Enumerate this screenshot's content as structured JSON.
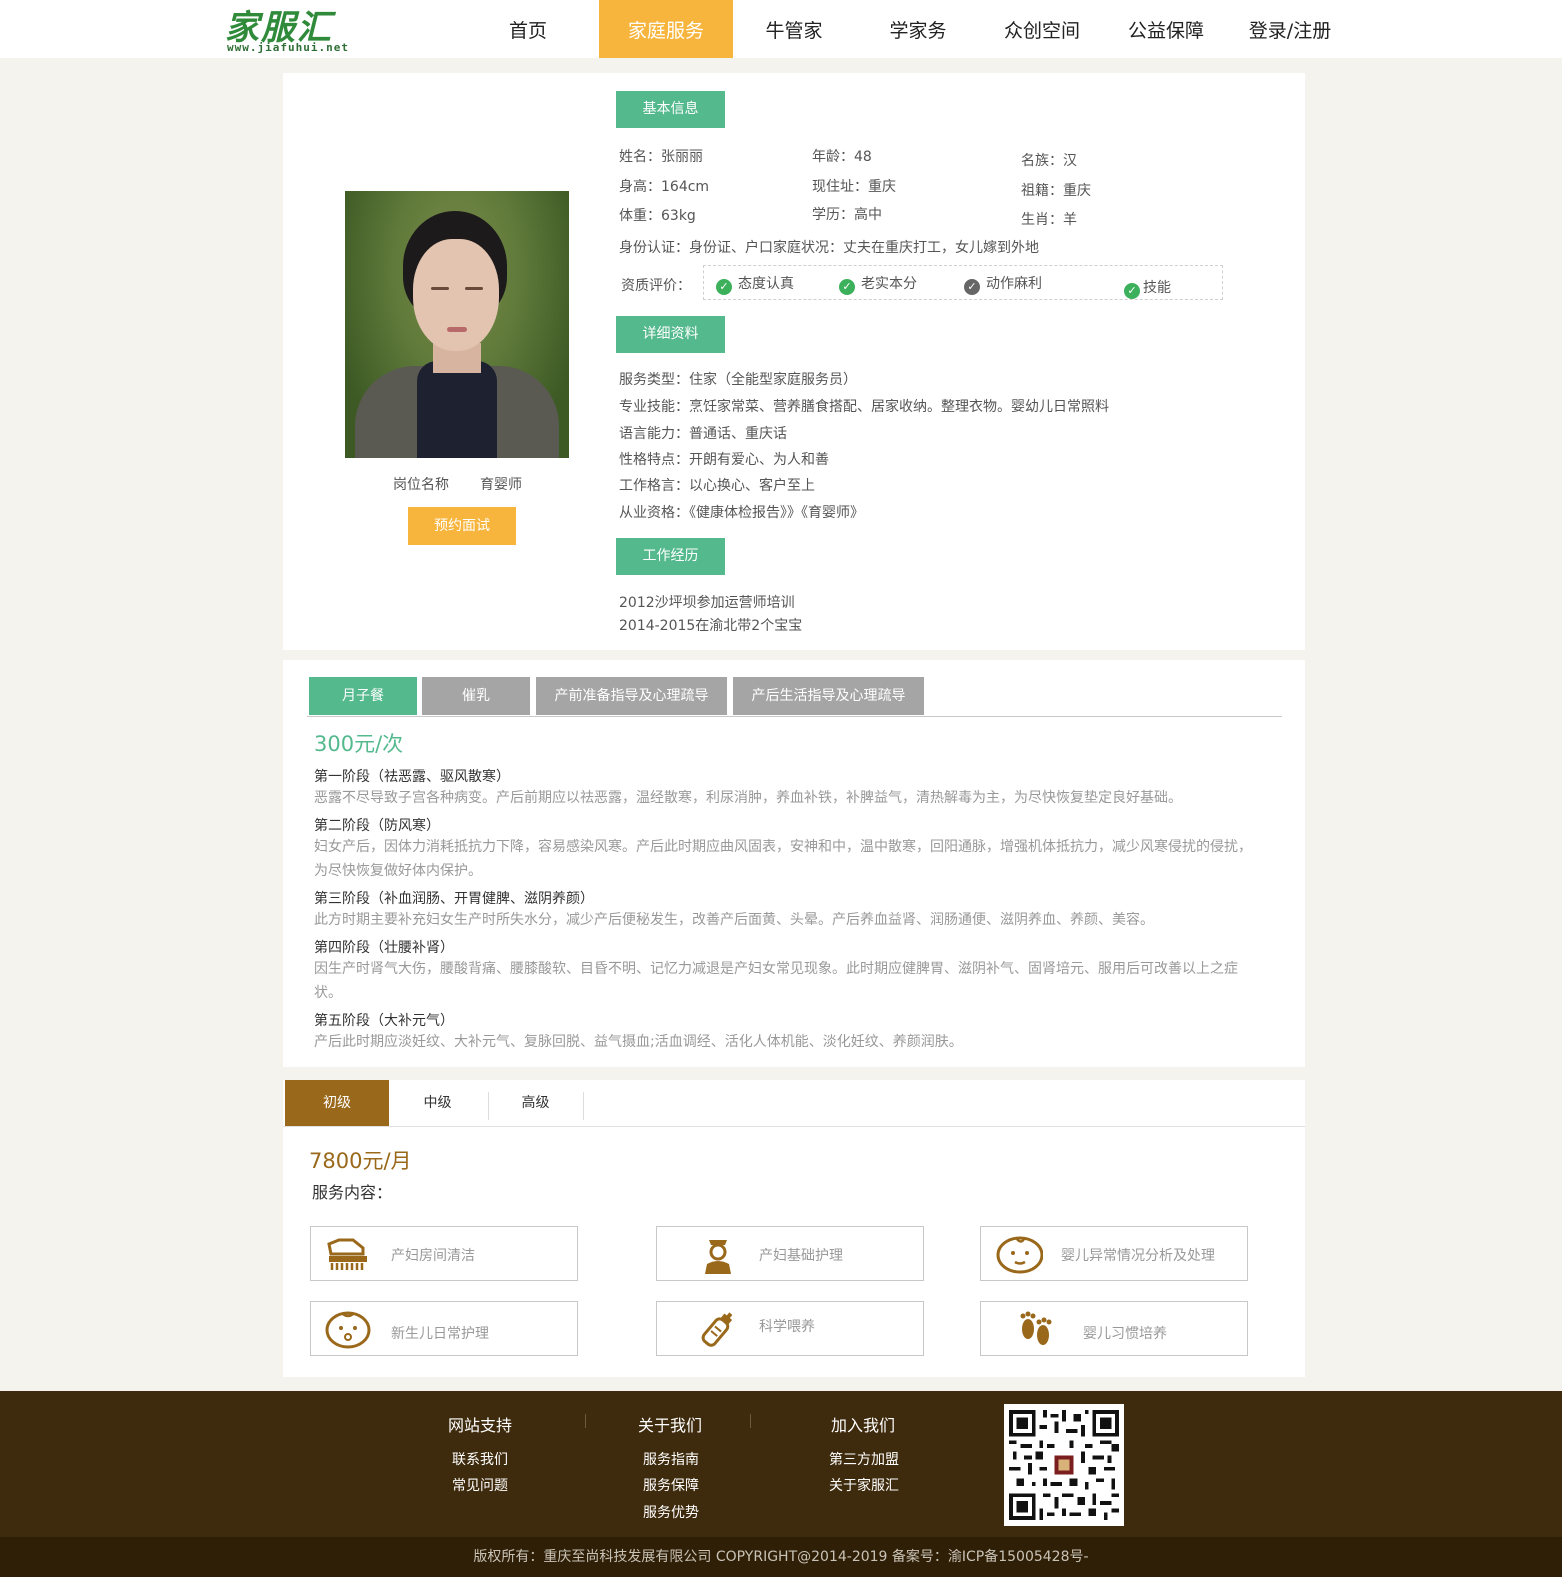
{
  "header": {
    "logo_text": "家服汇",
    "logo_url": "www.jiafuhui.net",
    "nav": [
      {
        "label": "首页"
      },
      {
        "label": "家庭服务"
      },
      {
        "label": "牛管家"
      },
      {
        "label": "学家务"
      },
      {
        "label": "众创空间"
      },
      {
        "label": "公益保障"
      },
      {
        "label": "登录/注册"
      }
    ],
    "active_color": "#f8b53d"
  },
  "profile": {
    "post_label": "岗位名称",
    "post_value": "育婴师",
    "book_button": "预约面试",
    "section_basic": "基本信息",
    "section_detail": "详细资料",
    "section_work": "工作经历",
    "basic": {
      "name": "姓名：张丽丽",
      "age": "年龄：48",
      "ethnicity": "名族：汉",
      "height": "身高：164cm",
      "address": "现住址：重庆",
      "origin": "祖籍：重庆",
      "weight": "体重：63kg",
      "education": "学历：高中",
      "zodiac": "生肖：羊",
      "identity": "身份认证：身份证、户口家庭状况：丈夫在重庆打工，女儿嫁到外地"
    },
    "qualification_label": "资质评价：",
    "qualifications": [
      "态度认真",
      "老实本分",
      "动作麻利",
      "技能"
    ],
    "details": [
      "服务类型：住家（全能型家庭服务员）",
      "专业技能：烹饪家常菜、营养膳食搭配、居家收纳。整理衣物。婴幼儿日常照料",
      "语言能力：普通话、重庆话",
      "性格特点：开朗有爱心、为人和善",
      "工作格言：以心换心、客户至上",
      "从业资格：《健康体检报告》》《育婴师》"
    ],
    "work": [
      "2012沙坪坝参加运营师培训",
      "2014-2015在渝北带2个宝宝"
    ],
    "accent_color": "#54b98d"
  },
  "meal": {
    "tabs": [
      {
        "label": "月子餐"
      },
      {
        "label": "催乳"
      },
      {
        "label": "产前准备指导及心理疏导"
      },
      {
        "label": "产后生活指导及心理疏导"
      }
    ],
    "price": "300元/次",
    "stages": [
      {
        "title": "第一阶段（祛恶露、驱风散寒）",
        "desc": "恶露不尽导致子宫各种病变。产后前期应以祛恶露，温经散寒，利尿消肿，养血补铁，补脾益气，清热解毒为主，为尽快恢复垫定良好基础。"
      },
      {
        "title": "第二阶段（防风寒）",
        "desc": "妇女产后，因体力消耗抵抗力下降，容易感染风寒。产后此时期应曲风固表，安神和中，温中散寒，回阳通脉，增强机体抵抗力，减少风寒侵扰的侵扰，为尽快恢复做好体内保护。"
      },
      {
        "title": "第三阶段（补血润肠、开胃健脾、滋阴养颜）",
        "desc": "此方时期主要补充妇女生产时所失水分，减少产后便秘发生，改善产后面黄、头晕。产后养血益肾、润肠通便、滋阴养血、养颜、美容。"
      },
      {
        "title": "第四阶段（壮腰补肾）",
        "desc": "因生产时肾气大伤，腰酸背痛、腰膝酸软、目昏不明、记忆力减退是产妇女常见现象。此时期应健脾胃、滋阴补气、固肾培元、服用后可改善以上之症状。"
      },
      {
        "title": "第五阶段（大补元气）",
        "desc": "产后此时期应淡妊纹、大补元气、复脉回脱、益气摄血;活血调经、活化人体机能、淡化妊纹、养颜润肤。"
      }
    ]
  },
  "level": {
    "tabs": [
      {
        "label": "初级"
      },
      {
        "label": "中级"
      },
      {
        "label": "高级"
      }
    ],
    "price": "7800元/月",
    "service_label": "服务内容：",
    "services": [
      {
        "label": "产妇房间清洁",
        "icon": "brush-icon"
      },
      {
        "label": "产妇基础护理",
        "icon": "nurse-icon"
      },
      {
        "label": "婴儿异常情况分析及处理",
        "icon": "baby-face-icon"
      },
      {
        "label": "新生儿日常护理",
        "icon": "newborn-icon"
      },
      {
        "label": "科学喂养",
        "icon": "bottle-icon"
      },
      {
        "label": "婴儿习惯培养",
        "icon": "footprint-icon"
      }
    ],
    "brand_color": "#99681a"
  },
  "footer": {
    "columns": [
      {
        "title": "网站支持",
        "links": [
          "联系我们",
          "常见问题"
        ]
      },
      {
        "title": "关于我们",
        "links": [
          "服务指南",
          "服务保障",
          "服务优势"
        ]
      },
      {
        "title": "加入我们",
        "links": [
          "第三方加盟",
          "关于家服汇"
        ]
      }
    ],
    "copyright": "版权所有：重庆至尚科技发展有限公司 COPYRIGHT@2014-2019 备案号：渝ICP备15005428号-",
    "background": "#3e2a0c"
  }
}
